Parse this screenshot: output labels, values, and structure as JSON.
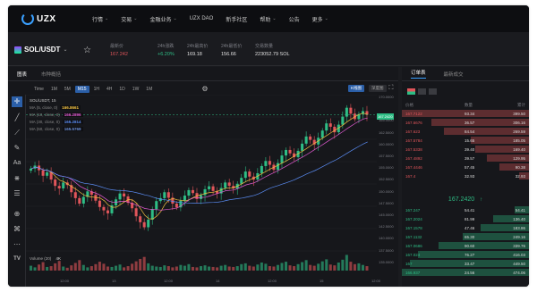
{
  "nav": {
    "logo": "UZX",
    "items": [
      {
        "label": "行情",
        "chevron": true
      },
      {
        "label": "交易",
        "chevron": true
      },
      {
        "label": "金融业务",
        "chevron": true
      },
      {
        "label": "UZX DAO",
        "chevron": false
      },
      {
        "label": "新手社区",
        "chevron": false
      },
      {
        "label": "帮助",
        "chevron": true
      },
      {
        "label": "公告",
        "chevron": false
      },
      {
        "label": "更多",
        "chevron": true
      }
    ]
  },
  "ticker": {
    "symbol": "SOL/USDT",
    "stats": [
      {
        "label": "最新价",
        "value": "167.242",
        "tone": "red"
      },
      {
        "label": "24h涨跌",
        "value": "+6.20%",
        "tone": "green"
      },
      {
        "label": "24h最高价",
        "value": "169.18",
        "tone": ""
      },
      {
        "label": "24h最低价",
        "value": "156.66",
        "tone": ""
      },
      {
        "label": "交易数量",
        "value": "223052.79 SOL",
        "tone": ""
      }
    ]
  },
  "chart_panel": {
    "tabs": [
      "图表",
      "市种概括"
    ],
    "timeframes": [
      "Time",
      "1M",
      "5M",
      "M15",
      "1H",
      "4H",
      "1D",
      "1W",
      "1M"
    ],
    "selected_timeframe": "M15",
    "kline_btn": "K线图",
    "depth_btn": "深度图",
    "legend": [
      {
        "text": "SOL/USDT, 15",
        "box": ""
      },
      {
        "text": "MA (5, close, 0)",
        "box": "166.8661"
      },
      {
        "text": "MA (10, close, 0)",
        "box": "166.2896"
      },
      {
        "text": "MA (30, close, 0)",
        "box": "165.2814"
      },
      {
        "text": "MA (60, close, 0)",
        "box": "165.5769"
      }
    ],
    "price_labels": [
      "170.0000",
      "167.2420",
      "165.0000",
      "162.5000",
      "160.0000",
      "157.5000",
      "155.0000",
      "152.5000",
      "150.0000",
      "147.5000",
      "145.0000",
      "142.5000",
      "140.0000",
      "137.5000",
      "135.0000"
    ],
    "last_price_tag": "167.2420",
    "volume_label": "Volume (20)",
    "volume_value": "4K",
    "time_labels": [
      "12:00",
      "13",
      "12:00",
      "14",
      "12:00",
      "15",
      "12:00"
    ]
  },
  "book": {
    "tabs": [
      "订单表",
      "最新成交"
    ],
    "headers": [
      "价格",
      "数量",
      "累计"
    ],
    "asks": [
      {
        "price": "167.7122",
        "qty": "93.34",
        "total": "399.50",
        "depth": 1.0
      },
      {
        "price": "167.6676",
        "qty": "36.57",
        "total": "306.16",
        "depth": 0.77
      },
      {
        "price": "167.623",
        "qty": "84.54",
        "total": "269.59",
        "depth": 0.67
      },
      {
        "price": "167.5784",
        "qty": "15.65",
        "total": "185.05",
        "depth": 0.46
      },
      {
        "price": "167.5338",
        "qty": "39.40",
        "total": "169.40",
        "depth": 0.42
      },
      {
        "price": "167.4892",
        "qty": "39.57",
        "total": "129.95",
        "depth": 0.33
      },
      {
        "price": "167.4446",
        "qty": "57.45",
        "total": "90.38",
        "depth": 0.23
      },
      {
        "price": "167.4",
        "qty": "32.93",
        "total": "32.93",
        "depth": 0.08
      }
    ],
    "mid_price": "167.2420",
    "mid_arrow": "↑",
    "bids": [
      {
        "price": "167.247",
        "qty": "54.41",
        "total": "54.41",
        "depth": 0.11
      },
      {
        "price": "167.2024",
        "qty": "81.99",
        "total": "136.40",
        "depth": 0.28
      },
      {
        "price": "167.1578",
        "qty": "47.46",
        "total": "183.86",
        "depth": 0.38
      },
      {
        "price": "167.1132",
        "qty": "65.30",
        "total": "249.16",
        "depth": 0.52
      },
      {
        "price": "167.0686",
        "qty": "90.60",
        "total": "339.76",
        "depth": 0.71
      },
      {
        "price": "167.024",
        "qty": "76.27",
        "total": "416.03",
        "depth": 0.87
      },
      {
        "price": "167",
        "qty": "33.47",
        "total": "449.50",
        "depth": 0.94
      },
      {
        "price": "166.937",
        "qty": "24.56",
        "total": "474.06",
        "depth": 1.0
      }
    ]
  },
  "chart_data": {
    "type": "candlestick",
    "title": "SOL/USDT, 15",
    "ylim": [
      135,
      172
    ],
    "x_labels": [
      "12:00",
      "13",
      "12:00",
      "14",
      "12:00",
      "15",
      "12:00"
    ],
    "close_series": [
      154.5,
      155.2,
      154.1,
      152.8,
      153.6,
      151.9,
      150.4,
      149.8,
      151.2,
      150.6,
      148.9,
      147.5,
      146.2,
      147.8,
      149.1,
      148.3,
      146.9,
      145.4,
      144.6,
      143.9,
      145.8,
      147.2,
      148.6,
      147.9,
      146.4,
      145.1,
      143.2,
      141.8,
      140.6,
      142.4,
      144.9,
      146.8,
      147.5,
      148.9,
      147.6,
      146.2,
      145.3,
      146.9,
      148.1,
      149.4,
      148.7,
      147.3,
      148.2,
      149.6,
      150.3,
      149.2,
      148.6,
      149.9,
      151.2,
      150.4,
      149.8,
      150.9,
      152.3,
      153.8,
      152.6,
      151.9,
      153.4,
      155.1,
      156.3,
      155.4,
      154.2,
      155.8,
      157.6,
      158.9,
      158.1,
      157.2,
      158.7,
      160.4,
      162.1,
      161.3,
      160.2,
      161.8,
      163.5,
      165.2,
      164.4,
      163.1,
      164.9,
      166.8,
      168.9,
      167.5,
      166.2,
      167.4,
      168.1,
      167.242
    ],
    "volume_k": [
      1.2,
      0.8,
      1.5,
      2.1,
      0.9,
      1.1,
      1.8,
      2.4,
      1.0,
      0.7,
      1.3,
      1.9,
      2.6,
      1.4,
      0.8,
      1.1,
      1.6,
      2.2,
      1.7,
      1.0,
      0.9,
      1.2,
      1.5,
      0.8,
      1.1,
      1.7,
      2.3,
      2.9,
      3.4,
      1.8,
      1.2,
      1.0,
      0.9,
      1.3,
      1.1,
      0.8,
      1.0,
      1.4,
      1.2,
      1.6,
      0.9,
      0.8,
      1.1,
      1.3,
      1.0,
      0.9,
      0.8,
      1.2,
      1.4,
      1.0,
      0.9,
      1.1,
      1.6,
      1.8,
      1.2,
      1.0,
      1.5,
      2.0,
      1.7,
      1.1,
      1.0,
      1.4,
      1.9,
      2.2,
      1.3,
      1.1,
      1.6,
      2.1,
      2.6,
      1.4,
      1.2,
      1.7,
      2.3,
      2.8,
      1.5,
      1.3,
      2.0,
      2.7,
      3.9,
      2.2,
      1.6,
      1.8,
      1.4,
      1.1
    ]
  }
}
